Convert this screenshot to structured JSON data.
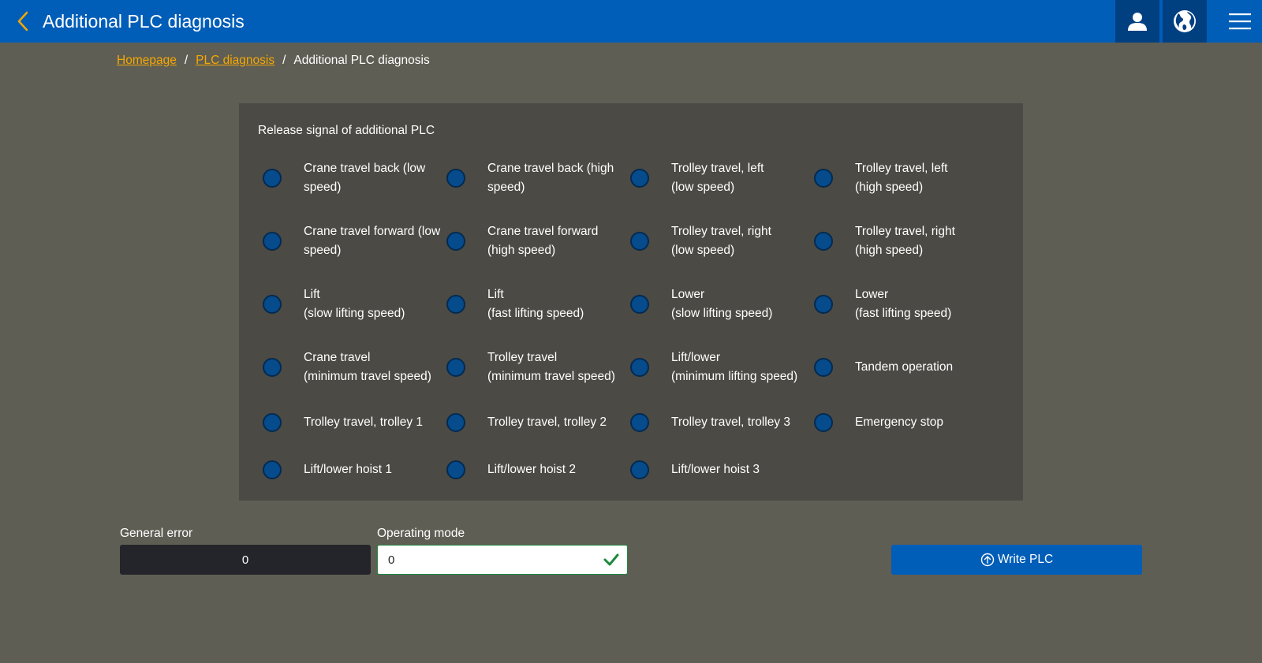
{
  "header": {
    "title": "Additional PLC diagnosis",
    "icons": [
      "chevron-left-icon",
      "user-icon",
      "globe-icon",
      "hamburger-menu-icon"
    ],
    "colors": {
      "bar": "#005eb8",
      "accent": "#f5a800",
      "icon_bg": "#003f80"
    }
  },
  "breadcrumb": {
    "items": [
      "Homepage",
      "PLC diagnosis",
      "Additional PLC diagnosis"
    ],
    "separator": "/"
  },
  "panel": {
    "title": "Release signal of additional PLC",
    "signals": [
      [
        "Crane travel back (low\nspeed)",
        "Crane travel back (high\nspeed)",
        "Trolley travel, left\n(low speed)",
        "Trolley travel, left\n(high speed)"
      ],
      [
        "Crane travel forward (low\nspeed)",
        "Crane travel forward\n(high speed)",
        "Trolley travel, right\n(low speed)",
        "Trolley travel, right\n(high speed)"
      ],
      [
        "Lift\n(slow lifting speed)",
        "Lift\n(fast lifting speed)",
        "Lower\n(slow lifting speed)",
        "Lower\n(fast lifting speed)"
      ],
      [
        "Crane travel\n(minimum travel speed)",
        "Trolley travel\n(minimum travel speed)",
        "Lift/lower\n(minimum lifting speed)",
        "Tandem operation"
      ],
      [
        "Trolley travel, trolley 1",
        "Trolley travel, trolley 2",
        "Trolley travel, trolley 3",
        "Emergency stop"
      ],
      [
        "Lift/lower hoist 1",
        "Lift/lower hoist 2",
        "Lift/lower hoist 3"
      ]
    ],
    "led_color": "#064b8c"
  },
  "general_error": {
    "label": "General error",
    "value": "0"
  },
  "operating_mode": {
    "label": "Operating mode",
    "value": "0"
  },
  "write_button": {
    "label": "Write PLC",
    "icon": "upload-circle-icon"
  }
}
